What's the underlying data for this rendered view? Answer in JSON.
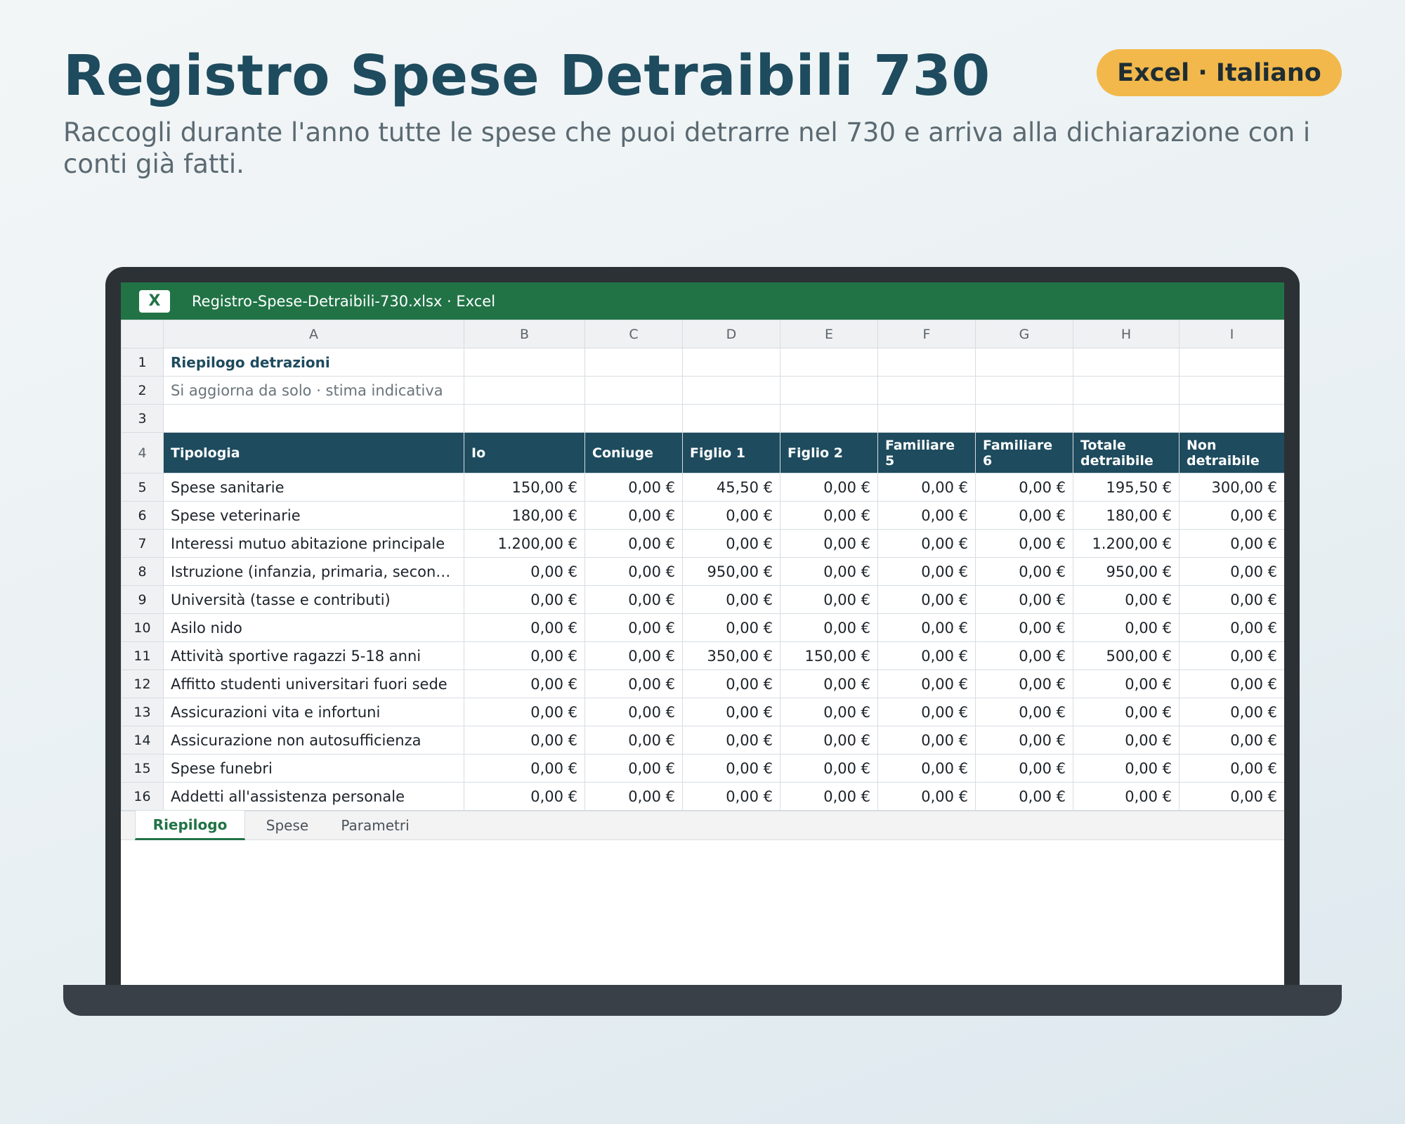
{
  "hero": {
    "title": "Registro Spese Detraibili 730",
    "badge": "Excel · Italiano",
    "subtitle": "Raccogli durante l'anno tutte le spese che puoi detrarre nel 730 e arriva alla dichiarazione con i conti già fatti."
  },
  "window": {
    "logo": "X",
    "title": "Registro-Spese-Detraibili-730.xlsx · Excel"
  },
  "columns": [
    "A",
    "B",
    "C",
    "D",
    "E",
    "F",
    "G",
    "H",
    "I"
  ],
  "sheet": {
    "title": "Riepilogo detrazioni",
    "subtitle": "Si aggiorna da solo · stima indicativa",
    "headers": [
      "Tipologia",
      "Io",
      "Coniuge",
      "Figlio 1",
      "Figlio 2",
      "Familiare 5",
      "Familiare 6",
      "Totale detraibile",
      "Non detraibile"
    ],
    "rows": [
      [
        "Spese sanitarie",
        "150,00 €",
        "0,00 €",
        "45,50 €",
        "0,00 €",
        "0,00 €",
        "0,00 €",
        "195,50 €",
        "300,00 €"
      ],
      [
        "Spese veterinarie",
        "180,00 €",
        "0,00 €",
        "0,00 €",
        "0,00 €",
        "0,00 €",
        "0,00 €",
        "180,00 €",
        "0,00 €"
      ],
      [
        "Interessi mutuo abitazione principale",
        "1.200,00 €",
        "0,00 €",
        "0,00 €",
        "0,00 €",
        "0,00 €",
        "0,00 €",
        "1.200,00 €",
        "0,00 €"
      ],
      [
        "Istruzione (infanzia, primaria, secondaria)",
        "0,00 €",
        "0,00 €",
        "950,00 €",
        "0,00 €",
        "0,00 €",
        "0,00 €",
        "950,00 €",
        "0,00 €"
      ],
      [
        "Università (tasse e contributi)",
        "0,00 €",
        "0,00 €",
        "0,00 €",
        "0,00 €",
        "0,00 €",
        "0,00 €",
        "0,00 €",
        "0,00 €"
      ],
      [
        "Asilo nido",
        "0,00 €",
        "0,00 €",
        "0,00 €",
        "0,00 €",
        "0,00 €",
        "0,00 €",
        "0,00 €",
        "0,00 €"
      ],
      [
        "Attività sportive ragazzi 5-18 anni",
        "0,00 €",
        "0,00 €",
        "350,00 €",
        "150,00 €",
        "0,00 €",
        "0,00 €",
        "500,00 €",
        "0,00 €"
      ],
      [
        "Affitto studenti universitari fuori sede",
        "0,00 €",
        "0,00 €",
        "0,00 €",
        "0,00 €",
        "0,00 €",
        "0,00 €",
        "0,00 €",
        "0,00 €"
      ],
      [
        "Assicurazioni vita e infortuni",
        "0,00 €",
        "0,00 €",
        "0,00 €",
        "0,00 €",
        "0,00 €",
        "0,00 €",
        "0,00 €",
        "0,00 €"
      ],
      [
        "Assicurazione non autosufficienza",
        "0,00 €",
        "0,00 €",
        "0,00 €",
        "0,00 €",
        "0,00 €",
        "0,00 €",
        "0,00 €",
        "0,00 €"
      ],
      [
        "Spese funebri",
        "0,00 €",
        "0,00 €",
        "0,00 €",
        "0,00 €",
        "0,00 €",
        "0,00 €",
        "0,00 €",
        "0,00 €"
      ],
      [
        "Addetti all'assistenza personale",
        "0,00 €",
        "0,00 €",
        "0,00 €",
        "0,00 €",
        "0,00 €",
        "0,00 €",
        "0,00 €",
        "0,00 €"
      ]
    ]
  },
  "tabs": [
    "Riepilogo",
    "Spese",
    "Parametri"
  ],
  "active_tab": "Riepilogo"
}
